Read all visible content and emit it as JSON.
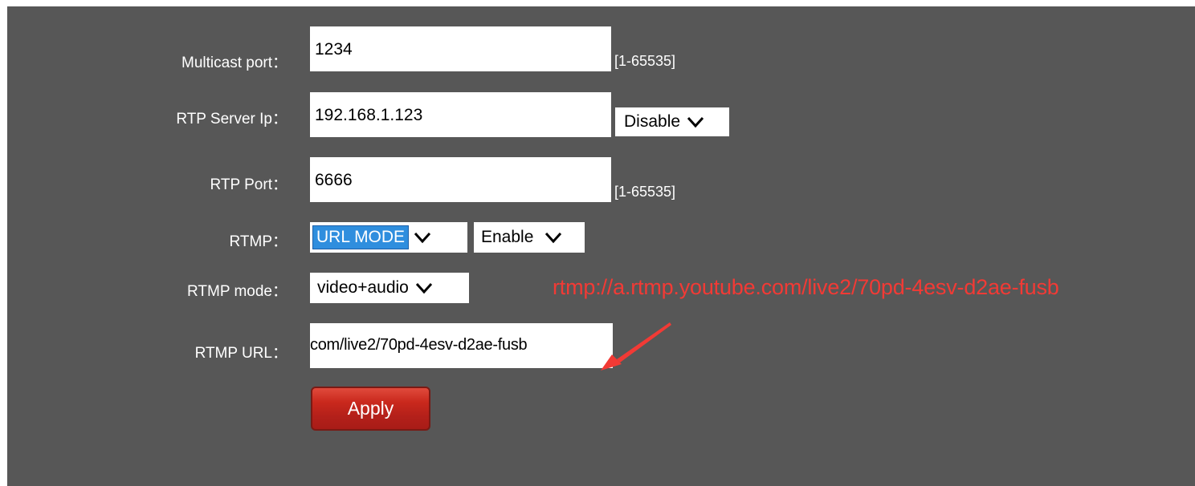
{
  "form": {
    "multicast_port": {
      "label": "Multicast port：",
      "value": "1234",
      "range": "[1-65535]"
    },
    "rtp_server_ip": {
      "label": "RTP Server Ip：",
      "value": "192.168.1.123",
      "select": "Disable"
    },
    "rtp_port": {
      "label": "RTP Port：",
      "value": "6666",
      "range": "[1-65535]"
    },
    "rtmp": {
      "label": "RTMP：",
      "mode_select": "URL MODE",
      "enable_select": "Enable"
    },
    "rtmp_mode": {
      "label": "RTMP mode：",
      "select": "video+audio"
    },
    "rtmp_url": {
      "label": "RTMP URL：",
      "value": "com/live2/70pd-4esv-d2ae-fusb"
    },
    "apply_label": "Apply"
  },
  "annotation": {
    "text": "rtmp://a.rtmp.youtube.com/live2/70pd-4esv-d2ae-fusb",
    "color": "#f23a35"
  },
  "icons": {
    "dropdown": "chevron-down-icon",
    "annotation_arrow": "arrow-icon"
  },
  "colors": {
    "panel_bg": "#575757",
    "selected_option": "#2f8ede",
    "apply_button": "#c9281c"
  }
}
